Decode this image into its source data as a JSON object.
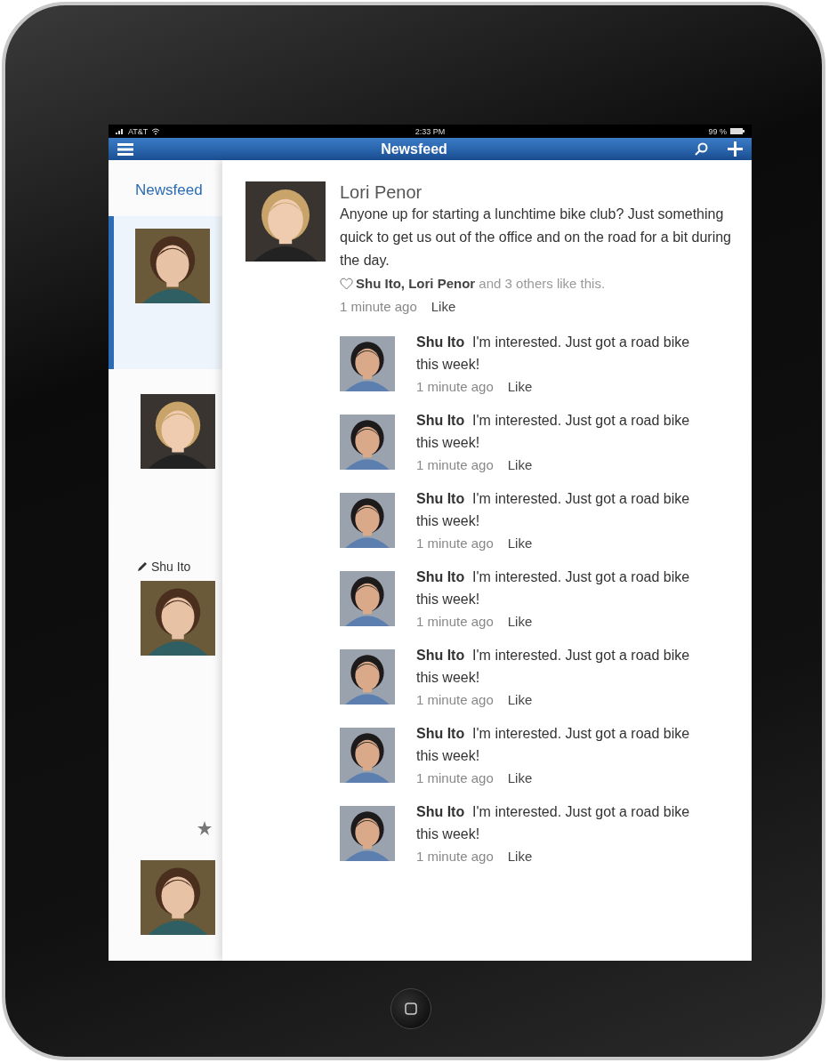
{
  "status_bar": {
    "carrier": "AT&T",
    "time": "2:33 PM",
    "battery": "99 %"
  },
  "header": {
    "title": "Newsfeed"
  },
  "sidebar": {
    "heading": "Newsfeed",
    "items": [
      {
        "selected": true
      },
      {
        "selected": false
      },
      {
        "selected": false,
        "byline": "Shu Ito",
        "starred": true
      },
      {
        "selected": false
      }
    ]
  },
  "post": {
    "author": "Lori Penor",
    "text": "Anyone up for starting a lunchtime bike club? Just something quick to get us out of the office and on the road for a bit during the day.",
    "likes": "**Shu Ito, Lori Penor** and 3 others like this.",
    "time": "1 minute ago",
    "like": "Like",
    "comments": [
      {
        "author": "Shu Ito",
        "text": "I'm interested. Just got a road bike this week!",
        "time": "1 minute ago",
        "like": "Like"
      },
      {
        "author": "Shu Ito",
        "text": "I'm interested. Just got a road bike this week!",
        "time": "1 minute ago",
        "like": "Like"
      },
      {
        "author": "Shu Ito",
        "text": "I'm interested. Just got a road bike this week!",
        "time": "1 minute ago",
        "like": "Like"
      },
      {
        "author": "Shu Ito",
        "text": "I'm interested. Just got a road bike this week!",
        "time": "1 minute ago",
        "like": "Like"
      },
      {
        "author": "Shu Ito",
        "text": "I'm interested. Just got a road bike this week!",
        "time": "1 minute ago",
        "like": "Like"
      },
      {
        "author": "Shu Ito",
        "text": "I'm interested. Just got a road bike this week!",
        "time": "1 minute ago",
        "like": "Like"
      },
      {
        "author": "Shu Ito",
        "text": "I'm interested. Just got a road bike this week!",
        "time": "1 minute ago",
        "like": "Like"
      }
    ]
  }
}
